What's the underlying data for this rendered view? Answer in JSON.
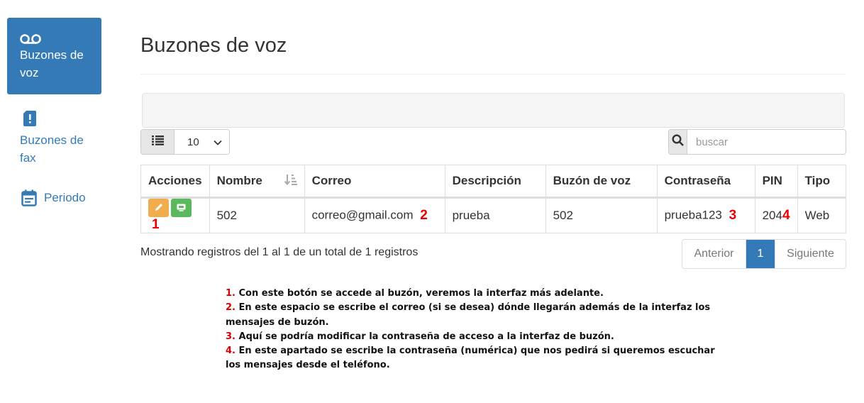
{
  "sidebar": {
    "items": [
      {
        "label": "Buzones de voz",
        "icon": "voicemail-icon",
        "active": true
      },
      {
        "label": "Buzones de fax",
        "icon": "fax-icon",
        "active": false
      },
      {
        "label": "Periodo",
        "icon": "calendar-icon",
        "active": false
      }
    ]
  },
  "page": {
    "title": "Buzones de voz"
  },
  "controls": {
    "page_size": "10",
    "search_placeholder": "buscar"
  },
  "table": {
    "headers": [
      "Acciones",
      "Nombre",
      "Correo",
      "Descripción",
      "Buzón de voz",
      "Contraseña",
      "PIN",
      "Tipo"
    ],
    "rows": [
      {
        "nombre": "502",
        "correo": "correo@gmail.com",
        "descripcion": "prueba",
        "buzon": "502",
        "contrasena": "prueba123",
        "pin": "204",
        "tipo": "Web"
      }
    ]
  },
  "markers": [
    "1",
    "2",
    "3",
    "4"
  ],
  "footer": {
    "records": "Mostrando registros del 1 al 1 de un total de 1 registros",
    "prev": "Anterior",
    "current": "1",
    "next": "Siguiente"
  },
  "notes": [
    {
      "num": "1.",
      "text": " Con este botón se accede al buzón, veremos la interfaz más adelante."
    },
    {
      "num": "2.",
      "text": " En este espacio se escribe el correo (si se desea) dónde llegarán además de la interfaz los mensajes de buzón."
    },
    {
      "num": "3.",
      "text": " Aquí se podría modificar la contraseña de acceso a la interfaz de buzón."
    },
    {
      "num": "4.",
      "text": " En este apartado se escribe la contraseña (numérica) que nos pedirá  si queremos escuchar los mensajes desde el teléfono."
    }
  ],
  "colors": {
    "primary": "#337ab7",
    "warning": "#f0ad4e",
    "success": "#5cb85c",
    "marker": "#e00000"
  }
}
